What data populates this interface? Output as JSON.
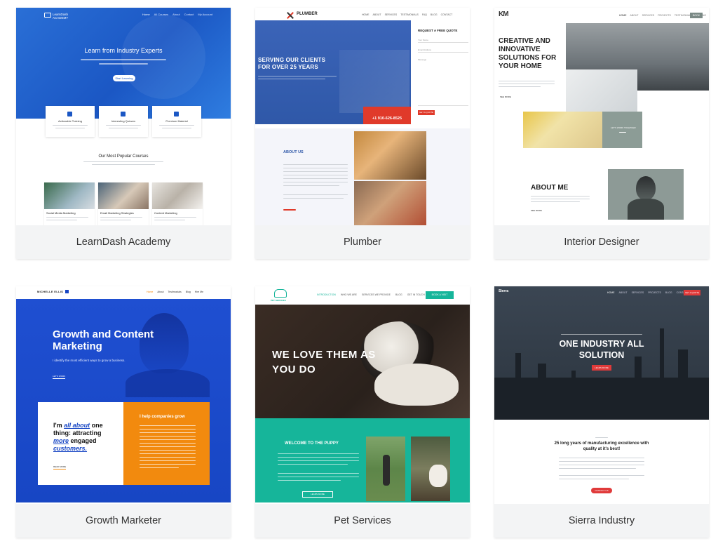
{
  "cards": [
    {
      "caption": "LearnDash Academy",
      "nav_logo": "LearnDash ACADEMY",
      "nav_items": [
        "Home",
        "All Courses",
        "About",
        "Contact",
        "My Account"
      ],
      "hero_title": "Learn from Industry Experts",
      "hero_button": "Start Learning",
      "features": [
        "Actionable Training",
        "Interesting Quizzes",
        "Premium Material"
      ],
      "section_title": "Our Most Popular Courses",
      "courses": [
        "Social Media Marketing",
        "Email Marketing Strategies",
        "Content Marketing"
      ]
    },
    {
      "caption": "Plumber",
      "logo": "PLUMBER",
      "nav_items": [
        "HOME",
        "ABOUT",
        "SERVICES",
        "TESTIMONIALS",
        "FAQ",
        "BLOG",
        "CONTACT"
      ],
      "hero_title": "SERVING OUR CLIENTS FOR OVER 25 YEARS",
      "quote_title": "REQUEST A FREE QUOTE",
      "quote_fields": [
        "Your Name",
        "Email Address",
        "Message"
      ],
      "quote_button": "GET A QUOTE",
      "phone": "+1 910-626-8525",
      "about_title": "ABOUT US"
    },
    {
      "caption": "Interior Designer",
      "logo": "KM",
      "nav_items": [
        "HOME",
        "ABOUT",
        "SERVICES",
        "PROJECTS",
        "TESTIMONIALS",
        "PRICING"
      ],
      "nav_button": "BOOK",
      "hero_title": "CREATIVE AND INNOVATIVE SOLUTIONS FOR YOUR HOME",
      "link_label": "SEE MORE",
      "cta_label": "LET'S WORK TOGETHER",
      "about_title": "ABOUT ME"
    },
    {
      "caption": "Growth Marketer",
      "logo": "MICHELLE ELLIS",
      "nav_items": [
        "Home",
        "About",
        "Testimonials",
        "Blog",
        "Hire Me"
      ],
      "hero_title": "Growth and Content Marketing",
      "hero_sub": "I identify the most efficient ways to grow a business.",
      "hero_link": "LET'S WORK",
      "box_title_parts": [
        "I'm ",
        "all about",
        " one thing: attracting ",
        "more",
        " engaged ",
        "customers."
      ],
      "box_link": "READ MORE",
      "orange_title": "I help companies grow"
    },
    {
      "caption": "Pet Services",
      "logo": "PET SERVICES",
      "nav_items": [
        "INTRODUCTION",
        "WHO WE ARE",
        "SERVICES WE PROVIDE",
        "BLOG",
        "GET IN TOUCH"
      ],
      "nav_button": "BOOK A VISIT",
      "hero_title": "WE LOVE THEM AS YOU DO",
      "welcome_title": "WELCOME TO THE PUPPY",
      "welcome_button": "LEARN MORE"
    },
    {
      "caption": "Sierra Industry",
      "logo": "Sierra",
      "nav_items": [
        "HOME",
        "ABOUT",
        "SERVICES",
        "PROJECTS",
        "BLOG",
        "CONTACT"
      ],
      "nav_button": "GET A QUOTE",
      "hero_title": "ONE INDUSTRY ALL SOLUTION",
      "hero_button": "LEARN MORE",
      "section_title": "25 long years of manufacturing excellence with quality at it's best!",
      "section_button": "CONTACT US"
    }
  ],
  "colors": {
    "card_bg": "#f3f4f5",
    "caption_text": "#333333",
    "learndash_blue": "#1b57c4",
    "plumber_red": "#e03a2a",
    "growth_blue": "#1746c4",
    "growth_orange": "#f28a0e",
    "pet_teal": "#16b59a",
    "sierra_red": "#e03a3a"
  }
}
